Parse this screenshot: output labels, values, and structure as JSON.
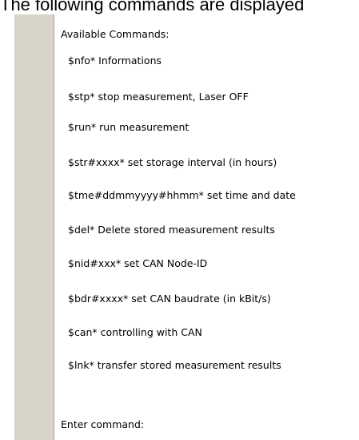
{
  "heading": "The following commands are displayed",
  "console": {
    "header": "Available Commands:",
    "commands": [
      "$nfo*  Informations",
      "$stp*  stop measurement, Laser OFF",
      "$run*  run measurement",
      "$str#xxxx*  set storage interval (in hours)",
      "$tme#ddmmyyyy#hhmm*  set time and date",
      "$del*  Delete stored measurement results",
      "$nid#xxx*  set CAN Node-ID",
      "$bdr#xxxx*  set CAN baudrate (in kBit/s)",
      "$can*  controlling with CAN",
      "$lnk*  transfer stored measurement results"
    ],
    "prompt": "Enter command:"
  }
}
